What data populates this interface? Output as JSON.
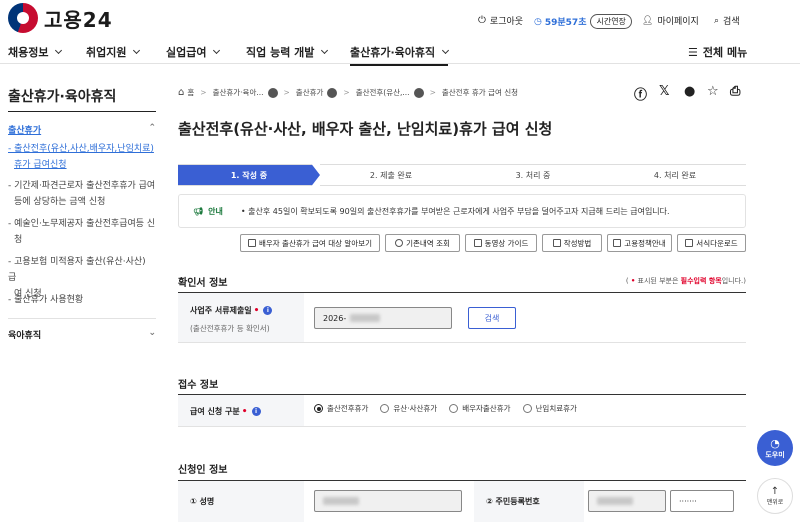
{
  "header": {
    "logo_text": "고용24",
    "logout": "로그아웃",
    "timer": "59분57초",
    "extend": "시간연장",
    "mypage": "마이페이지",
    "search": "검색"
  },
  "nav": {
    "items": [
      "채용정보",
      "취업지원",
      "실업급여",
      "직업 능력 개발",
      "출산휴가·육아휴직"
    ],
    "all_menu": "전체 메뉴"
  },
  "sidebar": {
    "title": "출산휴가·육아휴직",
    "section1": "출산휴가",
    "sub": [
      "- 출산전후(유산,사산,배우자,난임치료)",
      "휴가 급여신청",
      "- 기간제·파견근로자 출산전후휴가 급여",
      "등에 상당하는 금액 신청",
      "- 예술인·노무제공자 출산전후급여등 신",
      "청",
      "- 고용보험 미적용자 출산(유산·사산) 급",
      "여 신청",
      "- 출산휴가 사용현황"
    ],
    "section2": "육아휴직"
  },
  "breadcrumb": [
    "홈",
    "출산휴가·육아...",
    "출산휴가",
    "출산전후(유산,...",
    "출산전후 휴가 급여 신청"
  ],
  "page": {
    "title": "출산전후(유산·사산, 배우자 출산, 난임치료)휴가 급여 신청"
  },
  "steps": [
    "1. 작성 중",
    "2. 제출 완료",
    "3. 처리 중",
    "4. 처리 완료"
  ],
  "notice": {
    "label": "안내",
    "text": "• 출산후 45일이 확보되도록 90일의 출산전후휴가를 부여받은 근로자에게 사업주 부담을 덜어주고자 지급해 드리는 급여입니다."
  },
  "action_buttons": [
    "배우자 출산휴가 급여 대상 알아보기",
    "기존내역 조회",
    "동영상 가이드",
    "작성방법",
    "고용정책안내",
    "서식다운로드"
  ],
  "confirm": {
    "title": "확인서 정보",
    "req_note_pre": "( ",
    "req_star": "•",
    "req_note_mid": " 표시된 부분은 ",
    "req_note_bold": "필수입력 항목",
    "req_note_post": "입니다.)",
    "label": "사업주 서류제출일",
    "sublabel": "(출산전후휴가 등 확인서)",
    "date_value": "2026-",
    "search_btn": "검색"
  },
  "receipt": {
    "title": "접수 정보",
    "label": "급여 신청 구분",
    "options": [
      "출산전후휴가",
      "유산·사산휴가",
      "배우자출산휴가",
      "난임치료휴가"
    ],
    "selected": 0
  },
  "applicant": {
    "title": "신청인 정보",
    "name_label": "① 성명",
    "rrn_label": "② 주민등록번호",
    "rrn_masked": "·······"
  },
  "float": {
    "help": "도우미",
    "top": "맨위로"
  }
}
